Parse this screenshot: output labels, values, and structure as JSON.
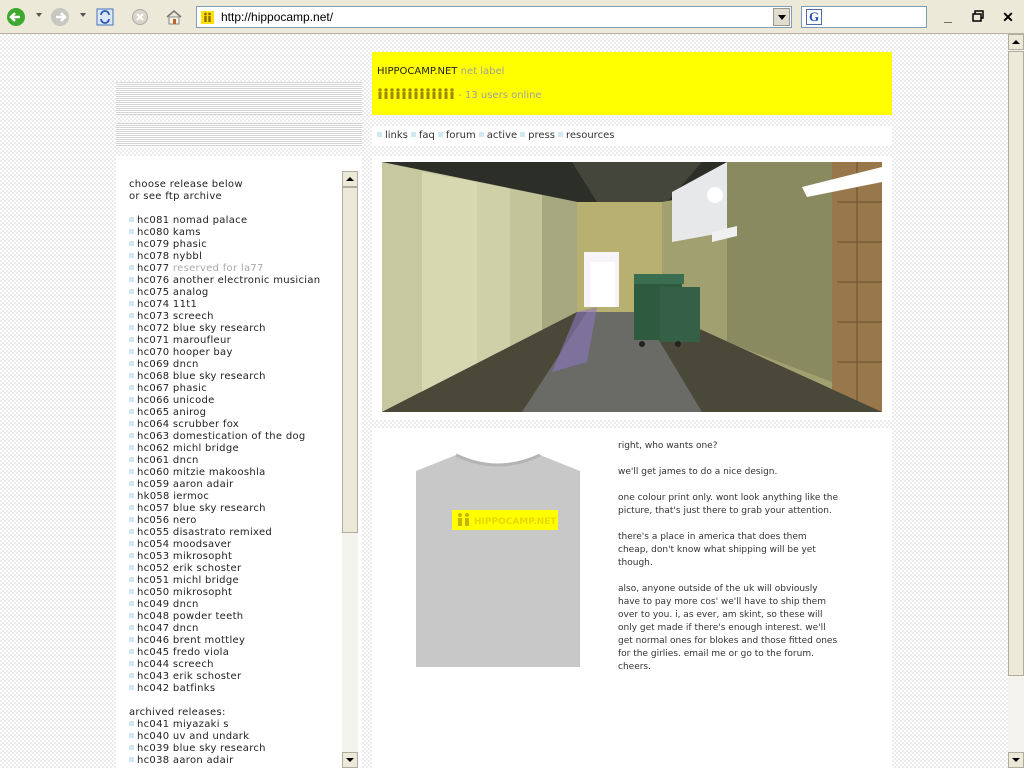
{
  "browser": {
    "url": "http://hippocamp.net/",
    "search_letter": "G"
  },
  "header": {
    "site_name": "HIPPOCAMP.NET",
    "tagline": "net label",
    "users_online": "- 13 users online",
    "user_count": 13
  },
  "nav": {
    "items": [
      "links",
      "faq",
      "forum",
      "active",
      "press",
      "resources"
    ]
  },
  "sidebar": {
    "intro_line1": "choose release below",
    "intro_line2_prefix": "or see",
    "intro_line2_link": "ftp archive",
    "releases": [
      {
        "code": "hc081",
        "name": "nomad palace"
      },
      {
        "code": "hc080",
        "name": "kams"
      },
      {
        "code": "hc079",
        "name": "phasic"
      },
      {
        "code": "hc078",
        "name": "nybbl"
      },
      {
        "code": "hc077",
        "name": "reserved for la77",
        "reserved": true
      },
      {
        "code": "hc076",
        "name": "another electronic musician"
      },
      {
        "code": "hc075",
        "name": "analog"
      },
      {
        "code": "hc074",
        "name": "11t1"
      },
      {
        "code": "hc073",
        "name": "screech"
      },
      {
        "code": "hc072",
        "name": "blue sky research"
      },
      {
        "code": "hc071",
        "name": "maroufleur"
      },
      {
        "code": "hc070",
        "name": "hooper bay"
      },
      {
        "code": "hc069",
        "name": "dncn"
      },
      {
        "code": "hc068",
        "name": "blue sky research"
      },
      {
        "code": "hc067",
        "name": "phasic"
      },
      {
        "code": "hc066",
        "name": "unicode"
      },
      {
        "code": "hc065",
        "name": "anirog"
      },
      {
        "code": "hc064",
        "name": "scrubber fox"
      },
      {
        "code": "hc063",
        "name": "domestication of the dog"
      },
      {
        "code": "hc062",
        "name": "michl bridge"
      },
      {
        "code": "hc061",
        "name": "dncn"
      },
      {
        "code": "hc060",
        "name": "mitzie makooshla"
      },
      {
        "code": "hc059",
        "name": "aaron adair"
      },
      {
        "code": "hk058",
        "name": "iermoc"
      },
      {
        "code": "hc057",
        "name": "blue sky research"
      },
      {
        "code": "hc056",
        "name": "nero"
      },
      {
        "code": "hc055",
        "name": "disastrato remixed"
      },
      {
        "code": "hc054",
        "name": "moodsaver"
      },
      {
        "code": "hc053",
        "name": "mikrosopht"
      },
      {
        "code": "hc052",
        "name": "erik schoster"
      },
      {
        "code": "hc051",
        "name": "michl bridge"
      },
      {
        "code": "hc050",
        "name": "mikrosopht"
      },
      {
        "code": "hc049",
        "name": "dncn"
      },
      {
        "code": "hc048",
        "name": "powder teeth"
      },
      {
        "code": "hc047",
        "name": "dncn"
      },
      {
        "code": "hc046",
        "name": "brent mottley"
      },
      {
        "code": "hc045",
        "name": "fredo viola"
      },
      {
        "code": "hc044",
        "name": "screech"
      },
      {
        "code": "hc043",
        "name": "erik schoster"
      },
      {
        "code": "hc042",
        "name": "batfinks"
      }
    ],
    "archived_title": "archived releases:",
    "archived": [
      {
        "code": "hc041",
        "name": "miyazaki s"
      },
      {
        "code": "hc040",
        "name": "uv and undark"
      },
      {
        "code": "hc039",
        "name": "blue sky research"
      },
      {
        "code": "hc038",
        "name": "aaron adair"
      }
    ]
  },
  "post": {
    "tshirt_logo": "HIPPOCAMP.NET",
    "paragraphs": [
      "right, who wants one?",
      "we'll get james to do a nice design.",
      "one colour print only. wont look anything like the picture, that's just there to grab your attention.",
      "there's a place in america that does them cheap, don't know what shipping will be yet though.",
      "also, anyone outside of the uk will obviously have to pay more cos' we'll have to ship them over to you. i, as ever, am skint, so these will only get made if there's enough interest. we'll get normal ones for blokes and those fitted ones for the girlies. email me or go to the forum. cheers."
    ]
  },
  "colors": {
    "header_bg": "#ffff00",
    "bullet": "#cfe8f2",
    "tshirt": "#c8c8c8",
    "muted_text": "#a0a0a0"
  }
}
